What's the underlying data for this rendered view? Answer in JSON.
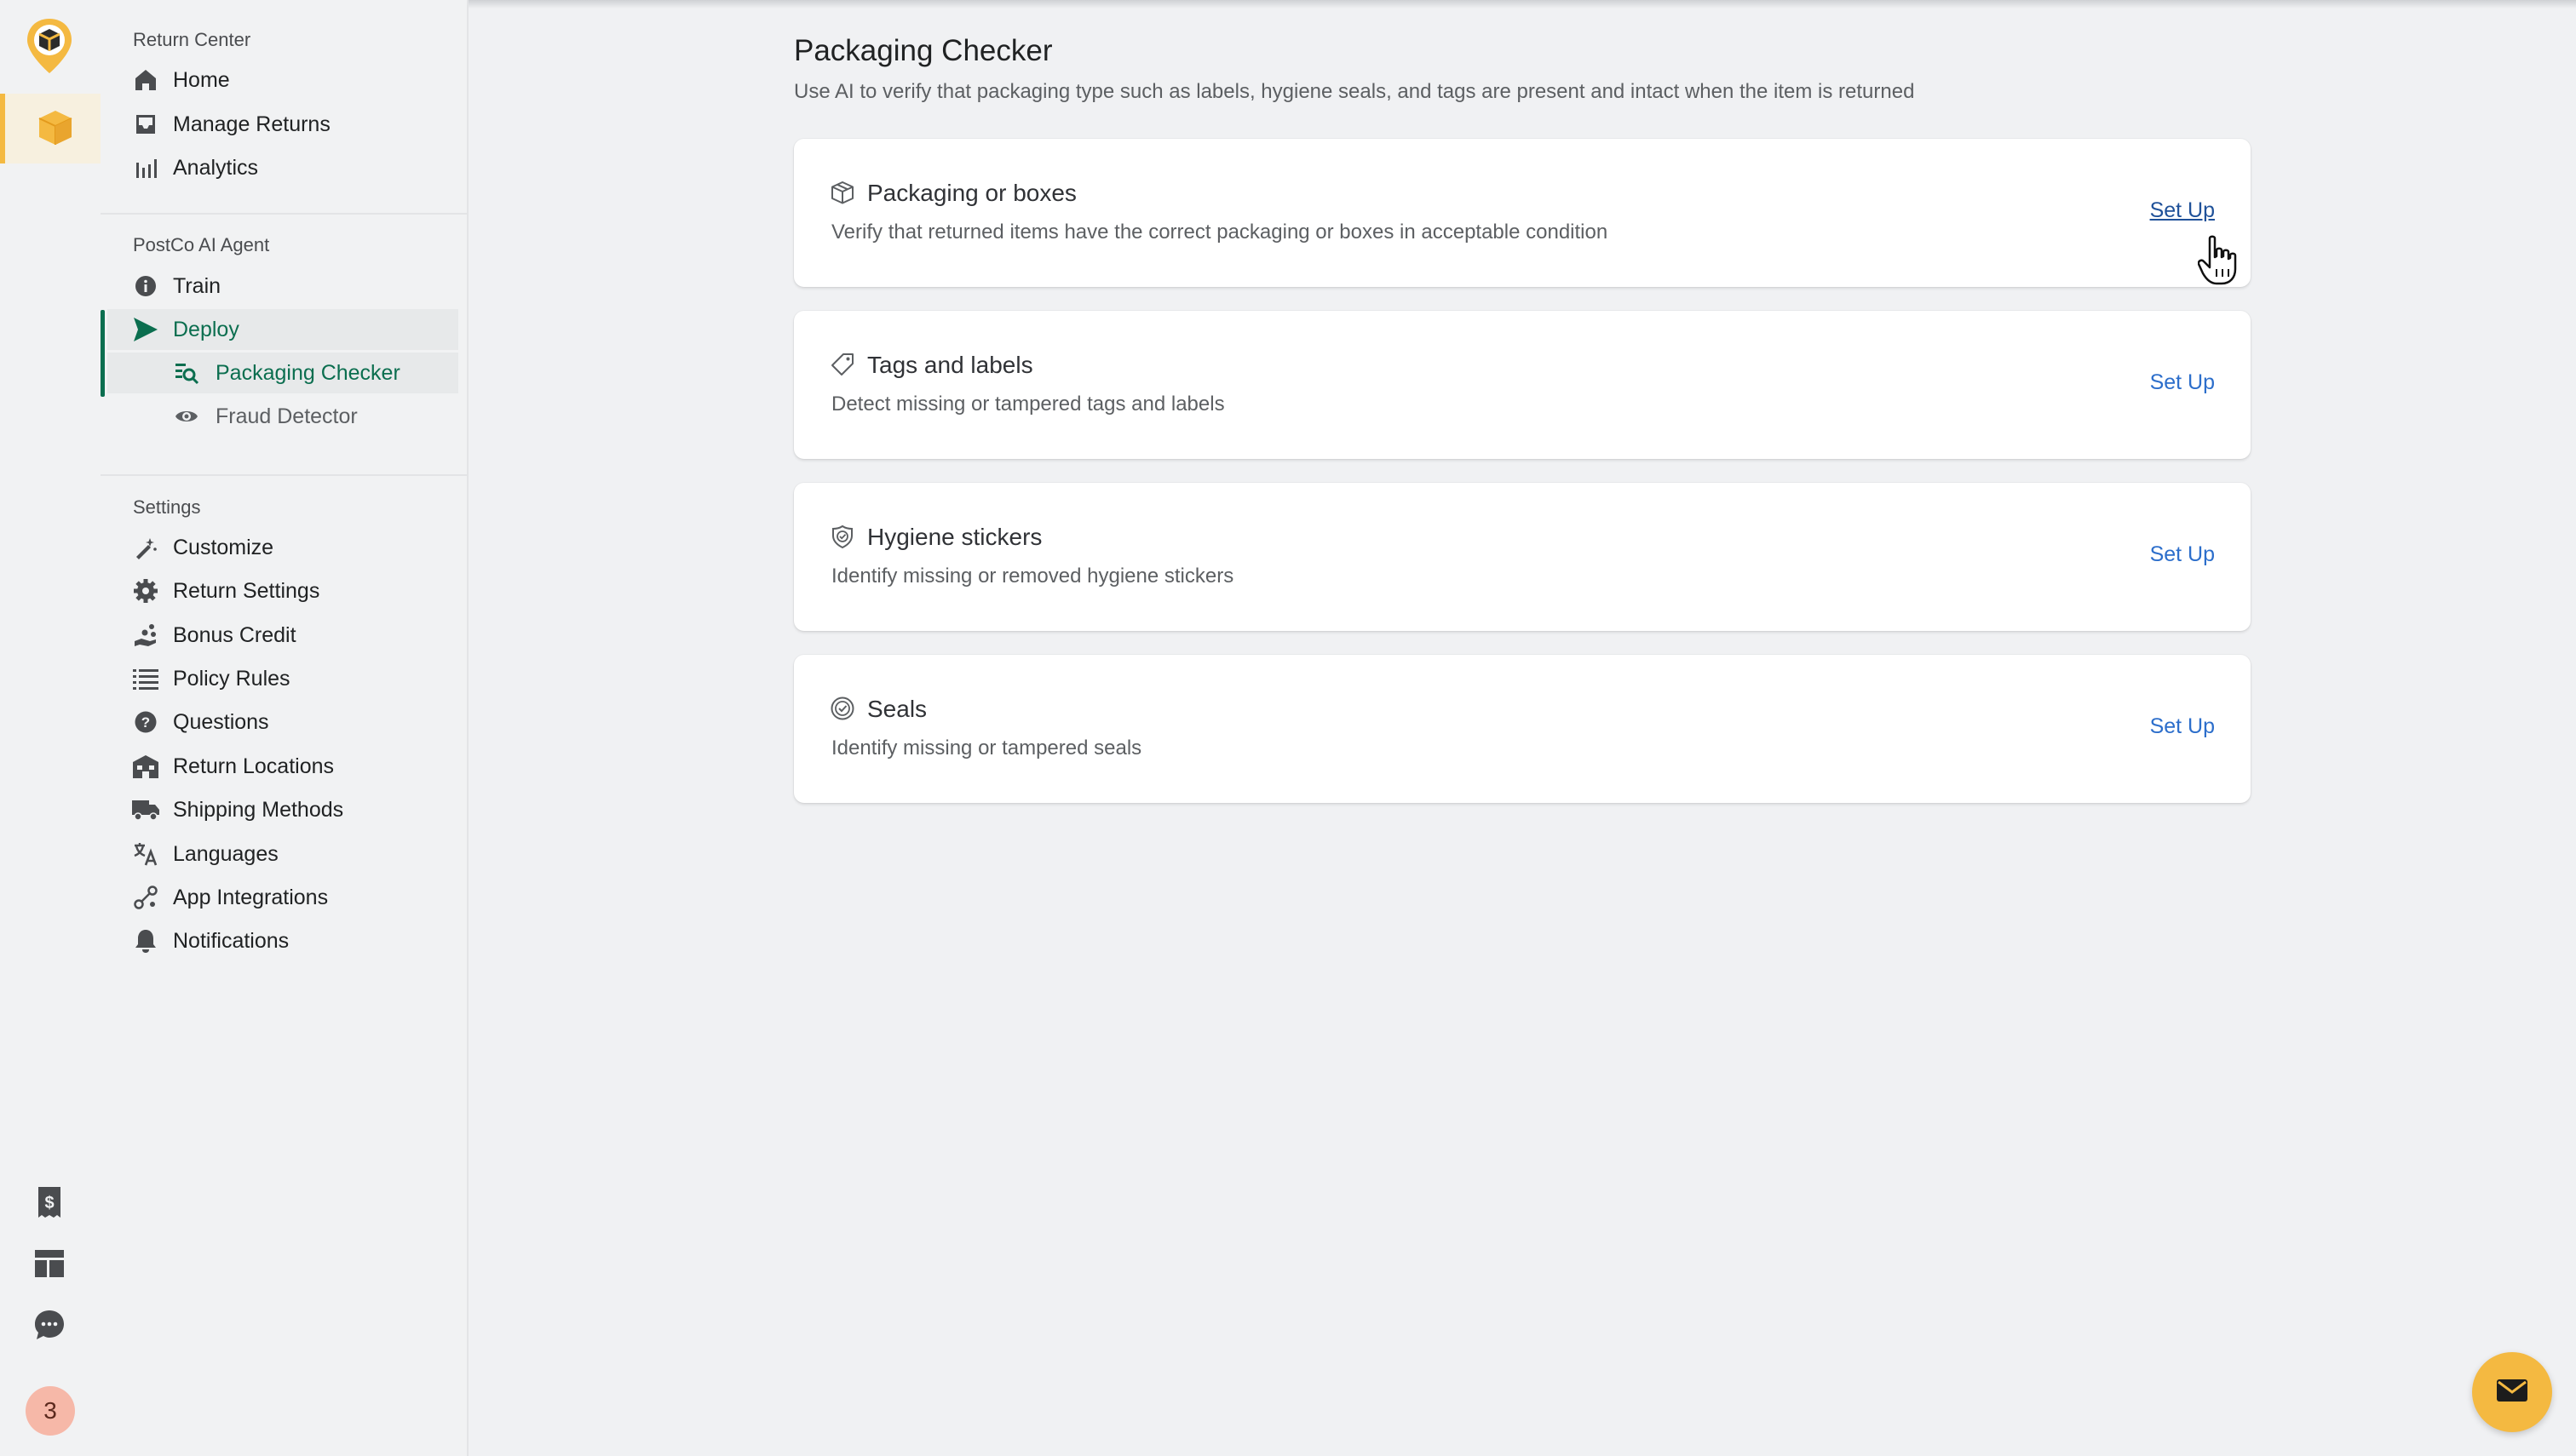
{
  "colors": {
    "accent_green": "#0b6e4f",
    "brand_yellow": "#f4b941",
    "link_blue": "#2c6ecb",
    "badge_bg": "#f6b8a8"
  },
  "rail": {
    "badge_count": "3",
    "icons": [
      "postco-logo-icon",
      "box-icon",
      "receipt-dollar-icon",
      "layout-icon",
      "chat-icon"
    ]
  },
  "sidebar": {
    "return_center": {
      "title": "Return Center",
      "items": [
        {
          "label": "Home",
          "icon": "home-icon"
        },
        {
          "label": "Manage Returns",
          "icon": "inbox-icon"
        },
        {
          "label": "Analytics",
          "icon": "bar-chart-icon"
        }
      ]
    },
    "ai_agent": {
      "title": "PostCo AI Agent",
      "items": [
        {
          "label": "Train",
          "icon": "info-icon"
        },
        {
          "label": "Deploy",
          "icon": "send-icon"
        },
        {
          "label": "Packaging Checker",
          "icon": "search-list-icon"
        },
        {
          "label": "Fraud Detector",
          "icon": "eye-icon"
        }
      ]
    },
    "settings": {
      "title": "Settings",
      "items": [
        {
          "label": "Customize",
          "icon": "magic-wand-icon"
        },
        {
          "label": "Return Settings",
          "icon": "gear-icon"
        },
        {
          "label": "Bonus Credit",
          "icon": "coins-icon"
        },
        {
          "label": "Policy Rules",
          "icon": "list-icon"
        },
        {
          "label": "Questions",
          "icon": "question-icon"
        },
        {
          "label": "Return Locations",
          "icon": "building-icon"
        },
        {
          "label": "Shipping Methods",
          "icon": "truck-icon"
        },
        {
          "label": "Languages",
          "icon": "translate-icon"
        },
        {
          "label": "App Integrations",
          "icon": "integration-icon"
        },
        {
          "label": "Notifications",
          "icon": "bell-icon"
        }
      ]
    }
  },
  "main": {
    "title": "Packaging Checker",
    "subtitle": "Use AI to verify that packaging type such as labels, hygiene seals, and tags are present and intact when the item is returned",
    "cards": [
      {
        "title": "Packaging or boxes",
        "description": "Verify that returned items have the correct packaging or boxes in acceptable condition",
        "action": "Set Up",
        "icon": "package-icon"
      },
      {
        "title": "Tags and labels",
        "description": "Detect missing or tampered tags and labels",
        "action": "Set Up",
        "icon": "tag-icon"
      },
      {
        "title": "Hygiene stickers",
        "description": "Identify missing or removed hygiene stickers",
        "action": "Set Up",
        "icon": "shield-check-icon"
      },
      {
        "title": "Seals",
        "description": "Identify missing or tampered seals",
        "action": "Set Up",
        "icon": "seal-check-icon"
      }
    ]
  },
  "fab": {
    "icon": "mail-icon"
  }
}
